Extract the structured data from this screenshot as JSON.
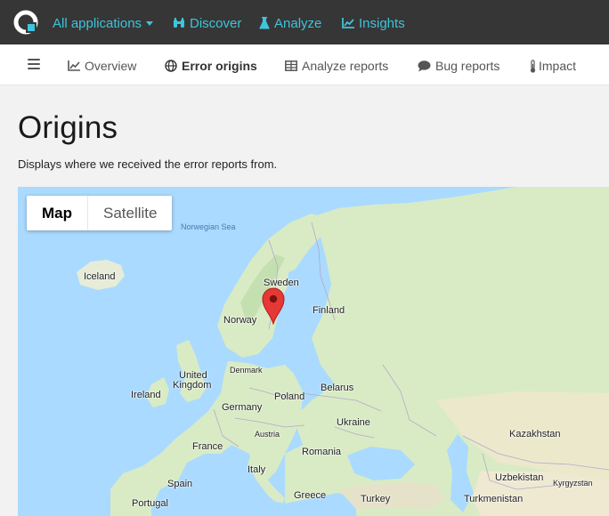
{
  "topnav": {
    "all_apps": "All applications",
    "discover": "Discover",
    "analyze": "Analyze",
    "insights": "Insights"
  },
  "subnav": {
    "overview": "Overview",
    "error_origins": "Error origins",
    "analyze_reports": "Analyze reports",
    "bug_reports": "Bug reports",
    "impact": "Impact"
  },
  "page": {
    "title": "Origins",
    "description": "Displays where we received the error reports from."
  },
  "map": {
    "type_map": "Map",
    "type_satellite": "Satellite",
    "selected_type": "Map",
    "labels": {
      "norwegian_sea": "Norwegian Sea",
      "iceland": "Iceland",
      "sweden": "Sweden",
      "norway": "Norway",
      "finland": "Finland",
      "united": "United",
      "kingdom": "Kingdom",
      "ireland": "Ireland",
      "denmark": "Denmark",
      "belarus": "Belarus",
      "poland": "Poland",
      "germany": "Germany",
      "ukraine": "Ukraine",
      "france": "France",
      "austria": "Austria",
      "romania": "Romania",
      "kazakhstan": "Kazakhstan",
      "italy": "Italy",
      "spain": "Spain",
      "uzbekistan": "Uzbekistan",
      "kyrgyzstan": "Kyrgyzstan",
      "greece": "Greece",
      "turkey": "Turkey",
      "turkmenistan": "Turkmenistan",
      "portugal": "Portugal"
    }
  },
  "colors": {
    "topbar": "#363636",
    "accent": "#3ec4dc",
    "water": "#aadaff",
    "land": "#d8ecc4",
    "pin": "#e53935"
  }
}
